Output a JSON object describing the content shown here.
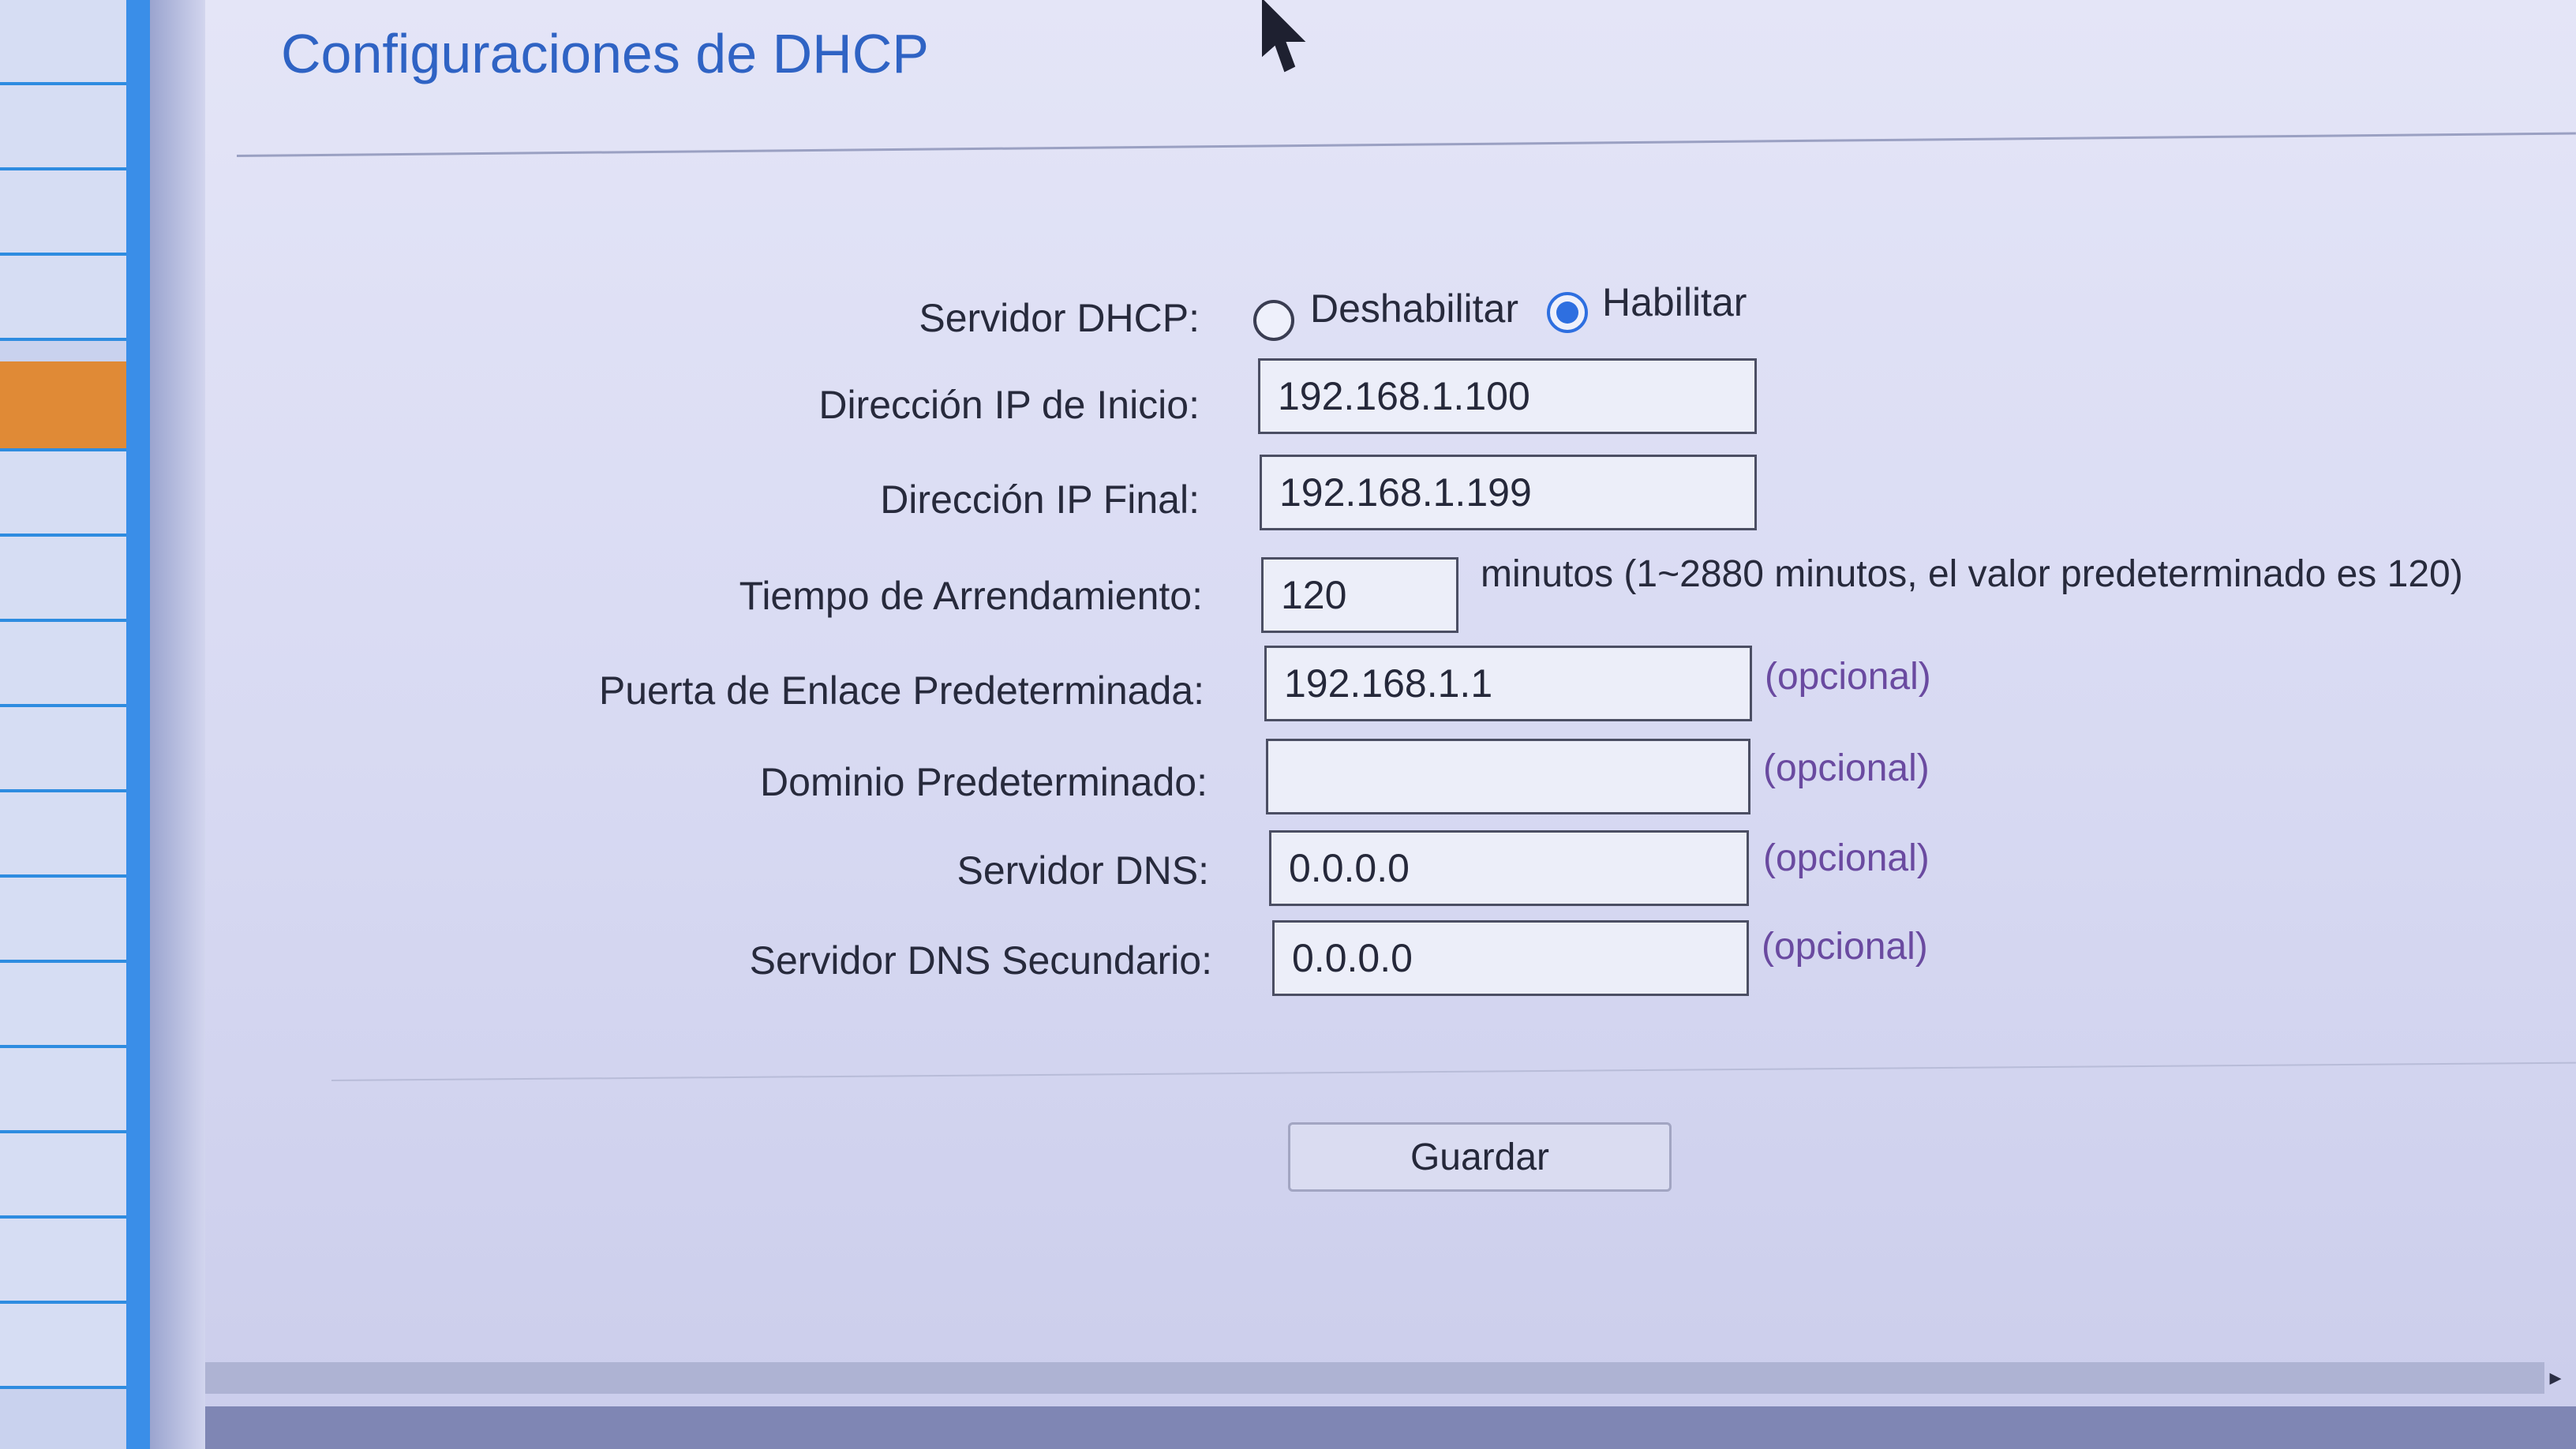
{
  "page": {
    "title": "Configuraciones de DHCP"
  },
  "dhcp_server": {
    "label": "Servidor DHCP:",
    "options": [
      {
        "label": "Deshabilitar",
        "selected": false
      },
      {
        "label": "Habilitar",
        "selected": true
      }
    ]
  },
  "start_ip": {
    "label": "Dirección IP de Inicio:",
    "value": "192.168.1.100"
  },
  "end_ip": {
    "label": "Dirección IP Final:",
    "value": "192.168.1.199"
  },
  "lease_time": {
    "label": "Tiempo de Arrendamiento:",
    "value": "120",
    "hint": "minutos (1~2880 minutos, el valor predeterminado es 120)"
  },
  "gateway": {
    "label": "Puerta de Enlace Predeterminada:",
    "value": "192.168.1.1",
    "hint": "(opcional)"
  },
  "domain": {
    "label": "Dominio Predeterminado:",
    "value": "",
    "hint": "(opcional)"
  },
  "dns_primary": {
    "label": "Servidor DNS:",
    "value": "0.0.0.0",
    "hint": "(opcional)"
  },
  "dns_secondary": {
    "label": "Servidor DNS Secundario:",
    "value": "0.0.0.0",
    "hint": "(opcional)"
  },
  "actions": {
    "save_label": "Guardar"
  },
  "colors": {
    "title": "#2f63c4",
    "accent": "#2e6fe0",
    "hint": "#6a4aa0",
    "nav_active": "#e08a36"
  },
  "icons": {
    "cursor": "mouse-pointer-icon",
    "scroll_right": "scroll-right-arrow-icon"
  }
}
